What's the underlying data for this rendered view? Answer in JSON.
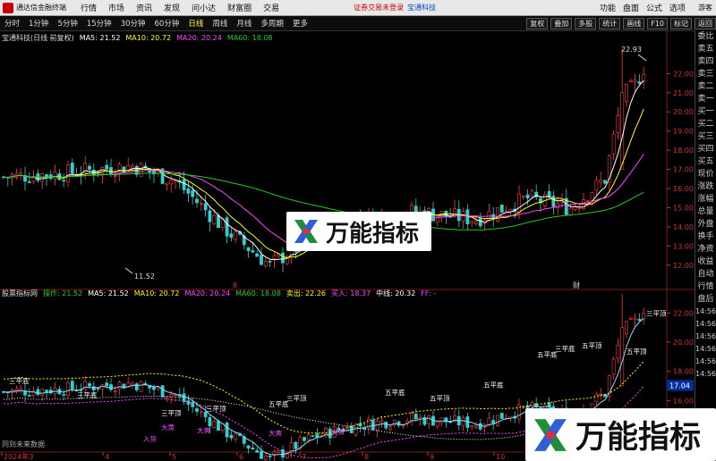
{
  "menubar": {
    "app_title": "通达信金融终端",
    "items": [
      "行情",
      "市场",
      "资讯",
      "发现",
      "问小达",
      "财富圈",
      "交易"
    ],
    "notice": "证券交易未登录",
    "stock_name": "宝通科技",
    "right_items": [
      "功能",
      "盘面",
      "公式",
      "选项"
    ],
    "guest": "游客"
  },
  "toolbar": {
    "periods": [
      "分时",
      "1分钟",
      "5分钟",
      "15分钟",
      "30分钟",
      "60分钟",
      "日线",
      "周线",
      "月线",
      "多周期",
      "更多"
    ],
    "active_period": "日线",
    "right_buttons": [
      "复权",
      "叠加",
      "多股",
      "统计",
      "画线",
      "F10",
      "标记",
      "返回"
    ]
  },
  "main_legend": {
    "title": "宝通科技(日线 前复权)",
    "ma5": "MA5: 21.52",
    "ma10": "MA10: 20.72",
    "ma20": "MA20: 20.24",
    "ma60": "MA60: 18.08"
  },
  "sub_legend": {
    "title": "股票指标网",
    "op": "操作: 21.52",
    "ma5": "MA5: 21.52",
    "ma10": "MA10: 20.72",
    "ma20": "MA20: 20.24",
    "ma60": "MA60: 18.08",
    "sell": "卖出: 22.26",
    "buy": "买入: 18.37",
    "mid": "中线: 20.32",
    "ff": "FF: -"
  },
  "main_price_axis": [
    "22.00",
    "21.00",
    "20.00",
    "19.00",
    "18.00",
    "17.00",
    "16.00",
    "15.00",
    "14.00",
    "13.00",
    "12.00"
  ],
  "sub_price_axis": [
    "22.00",
    "20.00",
    "18.00",
    "16.00",
    "14.00"
  ],
  "annotations": {
    "high": "22.93",
    "low": "11.52",
    "current": "17.04",
    "fin_mark": "财",
    "mark_8": "8"
  },
  "signal_labels": [
    "三平底",
    "三平底",
    "三平顶",
    "三平顶",
    "五平底",
    "三平顶",
    "五平底",
    "五平顶",
    "五平底",
    "五平底",
    "三平底",
    "五平顶",
    "五平顶",
    "三平顶",
    "大黄",
    "大黄",
    "大黄",
    "大黄",
    "入货"
  ],
  "time_axis": [
    "2024年3",
    "4",
    "5",
    "6",
    "7",
    "8",
    "9",
    "10",
    "11"
  ],
  "bottom_text": "同到未来数据",
  "side_panel": [
    "委比",
    "卖五",
    "卖四",
    "卖三",
    "卖二",
    "卖一",
    "买一",
    "买二",
    "买三",
    "买四",
    "买五",
    "现价",
    "涨跌",
    "涨幅",
    "总量",
    "外盘",
    "换手",
    "净资",
    "收益",
    "自动",
    "行情",
    "盘后",
    "14:56",
    "14:56",
    "14:56",
    "14:56",
    "14:56",
    "14:56"
  ],
  "watermark": {
    "text": "万能指标"
  },
  "colors": {
    "up": "#ff3b3b",
    "down": "#2fd0d0",
    "ma5": "#ffffff",
    "ma10": "#ffff00",
    "ma20": "#ff44ff",
    "ma60": "#22cc22",
    "up_fill": "#000000"
  }
}
